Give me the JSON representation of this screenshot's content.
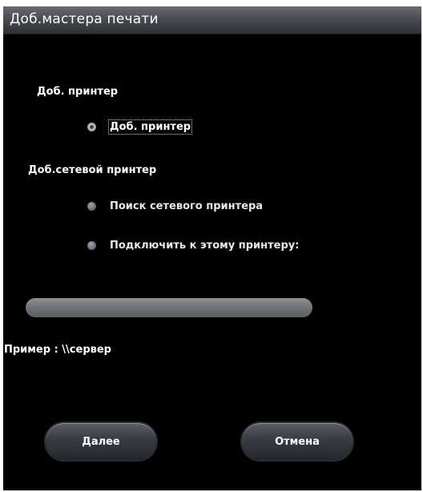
{
  "dialog": {
    "title": "Доб.мастера печати"
  },
  "local_printer": {
    "section_label": "Доб. принтер",
    "option_label": "Доб. принтер",
    "option_checked": true
  },
  "network_printer": {
    "section_label": "Доб.сетевой принтер",
    "options": [
      {
        "label": "Поиск сетевого принтера",
        "checked": false
      },
      {
        "label": "Подключить к этому принтеру:",
        "checked": false
      }
    ]
  },
  "path_field": {
    "value": "",
    "example_text": "Пример : \\\\сервер"
  },
  "buttons": {
    "next_label": "Далее",
    "cancel_label": "Отмена"
  },
  "colors": {
    "background": "#000000",
    "text": "#ffffff",
    "titlebar": "#4a4c52"
  }
}
